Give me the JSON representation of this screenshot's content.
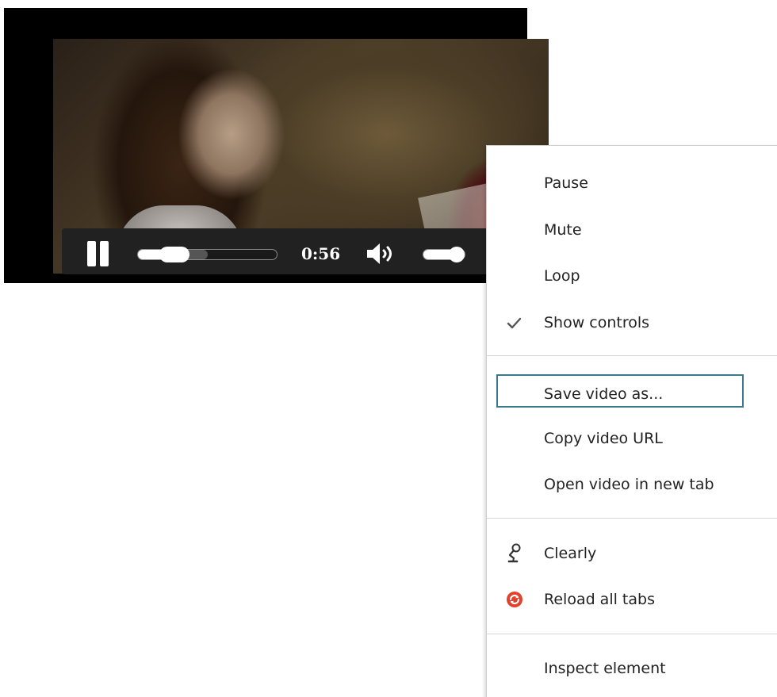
{
  "video": {
    "time": "0:56",
    "progress_percent": 34,
    "buffered_percent": 50,
    "volume_percent": 80,
    "state": "playing"
  },
  "context_menu": {
    "items": [
      {
        "label": "Pause",
        "checked": false,
        "icon": ""
      },
      {
        "label": "Mute",
        "checked": false,
        "icon": ""
      },
      {
        "label": "Loop",
        "checked": false,
        "icon": ""
      },
      {
        "label": "Show controls",
        "checked": true,
        "icon": "checkmark-icon"
      },
      {
        "label": "Save video as...",
        "focused": true,
        "icon": ""
      },
      {
        "label": "Copy video URL",
        "icon": ""
      },
      {
        "label": "Open video in new tab",
        "icon": ""
      },
      {
        "label": "Clearly",
        "icon": "desk-lamp-icon"
      },
      {
        "label": "Reload all tabs",
        "icon": "reload-all-tabs-icon"
      },
      {
        "label": "Inspect element",
        "icon": ""
      }
    ]
  },
  "colors": {
    "focus_ring": "#3b7a8a",
    "controls_bg": "#212121",
    "reload_icon": "#e2412d"
  }
}
